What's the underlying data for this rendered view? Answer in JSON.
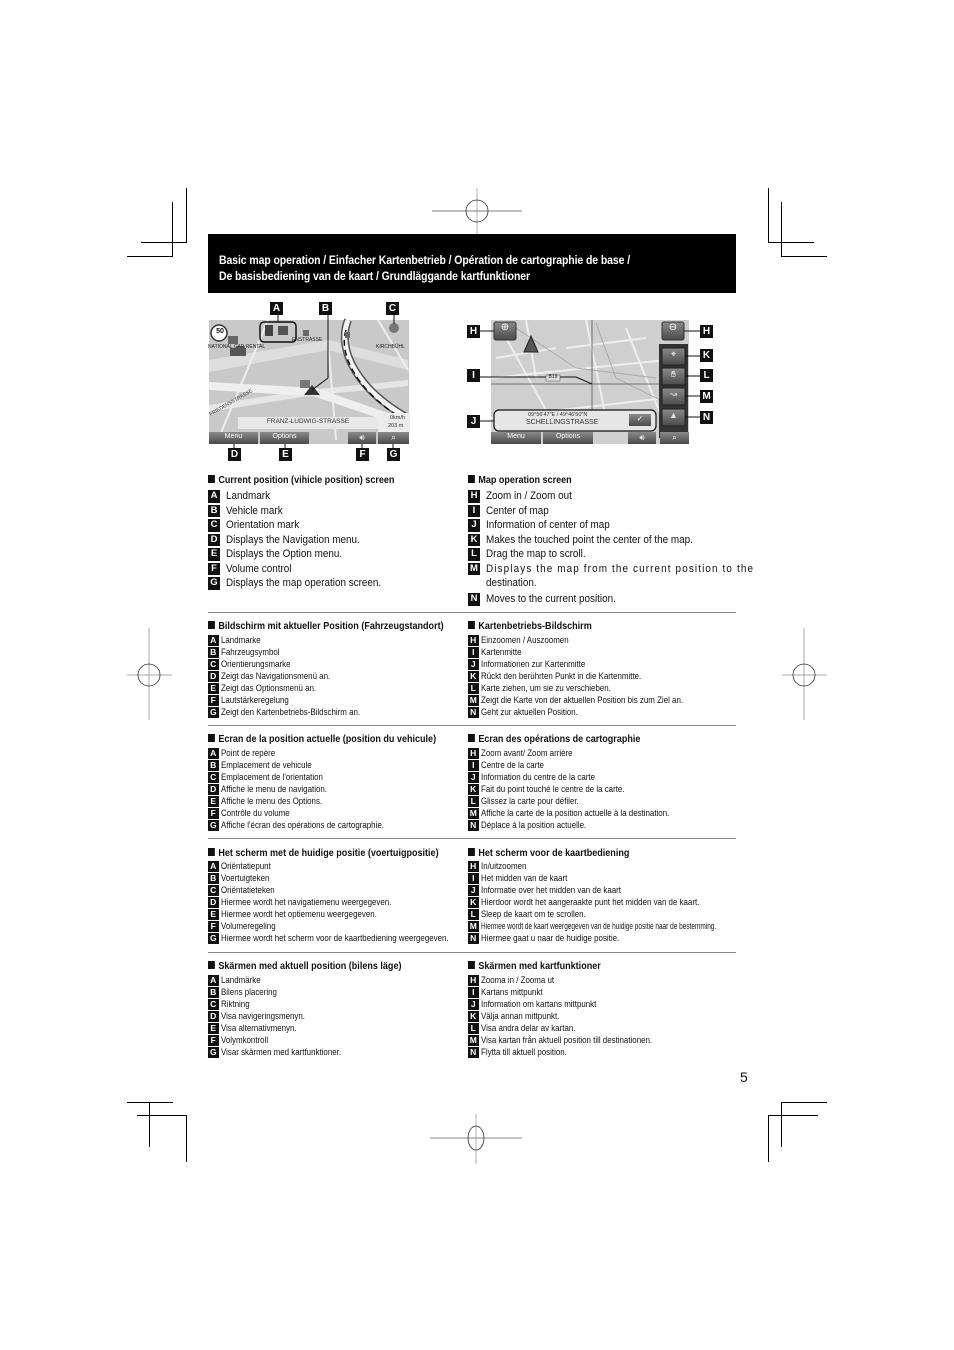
{
  "header": {
    "title_line1": "Basic map operation / Einfacher Kartenbetrieb / Opération de cartographie de base /",
    "title_line2": "De basisbediening van de kaart / Grundläggande kartfunktioner"
  },
  "screen_left": {
    "speed_limit": "50",
    "poi_label": "NATIONAL CAR RENTAL",
    "street_label_top": "ENSTRASSE",
    "street_label_right": "KIRCHBÜHL",
    "street_label_left": "FRIEDENSSTRASSE",
    "street_name": "FRANZ-LUDWIG-STRASSE",
    "speed_readout": "0km/h",
    "distance_readout": "203 m",
    "menu_label": "Menu",
    "options_label": "Options",
    "volume_icon": "speaker-icon",
    "map_op_icon": "map-magnifier-icon",
    "callouts": [
      "A",
      "B",
      "C",
      "D",
      "E",
      "F",
      "G"
    ]
  },
  "screen_right": {
    "coordinates": "09°56'47\"E / 49°46'50\"N",
    "street_name": "SCHELLINGSTRASSE",
    "road_number": "B19",
    "menu_label": "Menu",
    "options_label": "Options",
    "confirm_icon": "check-icon",
    "callouts": [
      "H",
      "H",
      "I",
      "J",
      "K",
      "L",
      "M",
      "N"
    ]
  },
  "english": {
    "left": {
      "title": "Current position (vihicle position) screen",
      "items": [
        {
          "letter": "A",
          "text": "Landmark"
        },
        {
          "letter": "B",
          "text": "Vehicle mark"
        },
        {
          "letter": "C",
          "text": "Orientation mark"
        },
        {
          "letter": "D",
          "text": "Displays the Navigation menu."
        },
        {
          "letter": "E",
          "text": "Displays the Option menu."
        },
        {
          "letter": "F",
          "text": "Volume control"
        },
        {
          "letter": "G",
          "text": "Displays the map operation screen."
        }
      ]
    },
    "right": {
      "title": "Map operation screen",
      "items": [
        {
          "letter": "H",
          "text": "Zoom in / Zoom out"
        },
        {
          "letter": "I",
          "text": "Center of map"
        },
        {
          "letter": "J",
          "text": "Information of center of map"
        },
        {
          "letter": "K",
          "text": "Makes the touched point the center of the map."
        },
        {
          "letter": "L",
          "text": "Drag the map to scroll."
        },
        {
          "letter": "M",
          "text": "Displays the map from the current position to the",
          "text2": "destination."
        },
        {
          "letter": "N",
          "text": "Moves to the current position."
        }
      ]
    }
  },
  "german": {
    "left": {
      "title": "Bildschirm mit aktueller Position (Fahrzeugstandort)",
      "items": [
        {
          "letter": "A",
          "text": "Landmarke"
        },
        {
          "letter": "B",
          "text": "Fahrzeugsymbol"
        },
        {
          "letter": "C",
          "text": "Orientierungsmarke"
        },
        {
          "letter": "D",
          "text": "Zeigt das Navigationsmenü an."
        },
        {
          "letter": "E",
          "text": "Zeigt das Optionsmenü an."
        },
        {
          "letter": "F",
          "text": "Lautstärkeregelung"
        },
        {
          "letter": "G",
          "text": "Zeigt den Kartenbetriebs-Bildschirm an."
        }
      ]
    },
    "right": {
      "title": "Kartenbetriebs-Bildschirm",
      "items": [
        {
          "letter": "H",
          "text": "Einzoomen / Auszoomen"
        },
        {
          "letter": "I",
          "text": "Kartenmitte"
        },
        {
          "letter": "J",
          "text": "Informationen zur Kartenmitte"
        },
        {
          "letter": "K",
          "text": "Rückt den berührten Punkt in die Kartenmitte."
        },
        {
          "letter": "L",
          "text": "Karte ziehen, um sie zu verschieben."
        },
        {
          "letter": "M",
          "text": "Zeigt die Karte von der aktuellen Position bis zum Ziel an."
        },
        {
          "letter": "N",
          "text": "Geht zur aktuellen Position."
        }
      ]
    }
  },
  "french": {
    "left": {
      "title": "Ecran de la position actuelle (position du vehicule)",
      "items": [
        {
          "letter": "A",
          "text": "Point de repère"
        },
        {
          "letter": "B",
          "text": "Emplacement de vehicule"
        },
        {
          "letter": "C",
          "text": "Emplacement de l'orientation"
        },
        {
          "letter": "D",
          "text": "Affiche le menu de navigation."
        },
        {
          "letter": "E",
          "text": "Affiche le menu des Options."
        },
        {
          "letter": "F",
          "text": "Contrôle du volume"
        },
        {
          "letter": "G",
          "text": "Affiche l'écran des opérations de cartographie."
        }
      ]
    },
    "right": {
      "title": "Ecran des opérations de cartographie",
      "items": [
        {
          "letter": "H",
          "text": "Zoom avant/ Zoom arrière"
        },
        {
          "letter": "I",
          "text": "Centre de la carte"
        },
        {
          "letter": "J",
          "text": "Information du centre de la carte"
        },
        {
          "letter": "K",
          "text": "Fait du point touché le centre de la carte."
        },
        {
          "letter": "L",
          "text": "Glissez la carte pour défiler."
        },
        {
          "letter": "M",
          "text": "Affiche la carte de la position actuelle à la destination."
        },
        {
          "letter": "N",
          "text": "Déplace à la position actuelle."
        }
      ]
    }
  },
  "dutch": {
    "left": {
      "title": "Het scherm met de huidige positie (voertuigpositie)",
      "items": [
        {
          "letter": "A",
          "text": "Oriëntatiepunt"
        },
        {
          "letter": "B",
          "text": "Voertuigteken"
        },
        {
          "letter": "C",
          "text": "Oriëntatieteken"
        },
        {
          "letter": "D",
          "text": "Hiermee wordt het navigatiemenu weergegeven."
        },
        {
          "letter": "E",
          "text": "Hiermee wordt het optiemenu weergegeven."
        },
        {
          "letter": "F",
          "text": "Volumeregeling"
        },
        {
          "letter": "G",
          "text": "Hiermee wordt het scherm voor de kaartbediening weergegeven."
        }
      ]
    },
    "right": {
      "title": "Het scherm voor de kaartbediening",
      "items": [
        {
          "letter": "H",
          "text": "In/uitzoomen"
        },
        {
          "letter": "I",
          "text": "Het midden van de kaart"
        },
        {
          "letter": "J",
          "text": "Informatie over het midden van de kaart"
        },
        {
          "letter": "K",
          "text": "Hierdoor wordt het aangeraakte punt het midden van de kaart."
        },
        {
          "letter": "L",
          "text": "Sleep de kaart om te scrollen."
        },
        {
          "letter": "M",
          "text": "Hiermee wordt de kaart weergegeven van de huidige positie naar de bestemming."
        },
        {
          "letter": "N",
          "text": "Hiermee gaat u naar de huidige positie."
        }
      ]
    }
  },
  "swedish": {
    "left": {
      "title": "Skärmen med aktuell position (bilens läge)",
      "items": [
        {
          "letter": "A",
          "text": "Landmärke"
        },
        {
          "letter": "B",
          "text": "Bilens placering"
        },
        {
          "letter": "C",
          "text": "Riktning"
        },
        {
          "letter": "D",
          "text": "Visa navigeringsmenyn."
        },
        {
          "letter": "E",
          "text": "Visa alternativmenyn."
        },
        {
          "letter": "F",
          "text": "Volymkontroll"
        },
        {
          "letter": "G",
          "text": "Visar skärmen med kartfunktioner."
        }
      ]
    },
    "right": {
      "title": "Skärmen med kartfunktioner",
      "items": [
        {
          "letter": "H",
          "text": "Zooma in / Zooma ut"
        },
        {
          "letter": "I",
          "text": "Kartans mittpunkt"
        },
        {
          "letter": "J",
          "text": "Information om kartans mittpunkt"
        },
        {
          "letter": "K",
          "text": "Välja annan mittpunkt."
        },
        {
          "letter": "L",
          "text": "Visa andra delar av kartan."
        },
        {
          "letter": "M",
          "text": "Visa kartan från aktuell position till destinationen."
        },
        {
          "letter": "N",
          "text": "Flytta till aktuell position."
        }
      ]
    }
  },
  "page_number": "5"
}
